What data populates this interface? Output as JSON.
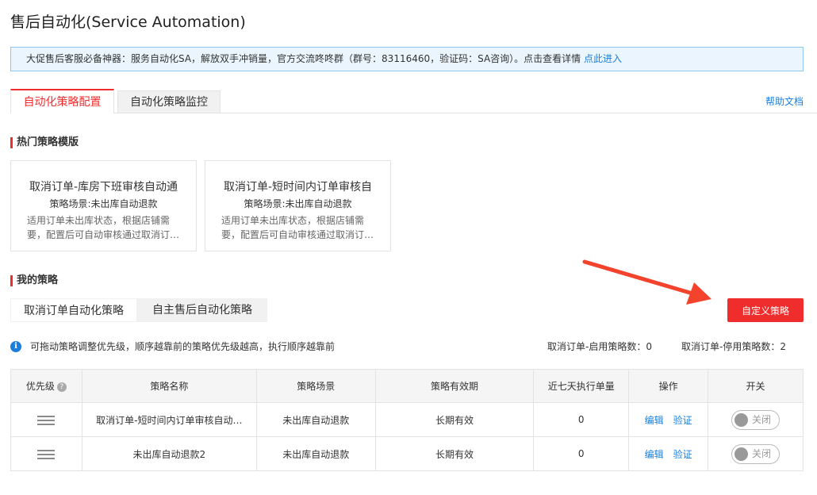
{
  "page": {
    "title": "售后自动化(Service Automation)"
  },
  "notice": {
    "text": "大促售后客服必备神器：服务自动化SA，解放双手冲销量，官方交流咚咚群（群号：83116460，验证码：SA咨询）。点击查看详情 ",
    "link": "点此进入"
  },
  "tabs": {
    "config": "自动化策略配置",
    "monitor": "自动化策略监控",
    "help": "帮助文档"
  },
  "hot": {
    "title": "热门策略模版",
    "cards": [
      {
        "title": "取消订单-库房下班审核自动通",
        "scene": "策略场景:未出库自动退款",
        "desc": "适用订单未出库状态，根据店铺需要，配置后可自动审核通过取消订…"
      },
      {
        "title": "取消订单-短时间内订单审核自",
        "scene": "策略场景:未出库自动退款",
        "desc": "适用订单未出库状态，根据店铺需要，配置后可自动审核通过取消订…"
      }
    ]
  },
  "mine": {
    "title": "我的策略",
    "subtabs": {
      "cancel": "取消订单自动化策略",
      "aftersale": "自主售后自动化策略"
    },
    "custom_button": "自定义策略",
    "tip": "可拖动策略调整优先级，顺序越靠前的策略优先级越高，执行顺序越靠前",
    "stats": {
      "enabled": "取消订单-启用策略数：0",
      "disabled": "取消订单-停用策略数：2"
    }
  },
  "table": {
    "headers": {
      "priority": "优先级",
      "name": "策略名称",
      "scene": "策略场景",
      "validity": "策略有效期",
      "count": "近七天执行单量",
      "ops": "操作",
      "switch": "开关"
    },
    "rows": [
      {
        "name": "取消订单-短时间内订单审核自动…",
        "scene": "未出库自动退款",
        "validity": "长期有效",
        "count": "0",
        "edit": "编辑",
        "verify": "验证",
        "switch": "关闭"
      },
      {
        "name": "未出库自动退款2",
        "scene": "未出库自动退款",
        "validity": "长期有效",
        "count": "0",
        "edit": "编辑",
        "verify": "验证",
        "switch": "关闭"
      }
    ]
  },
  "colors": {
    "accent": "#f02d2d",
    "link": "#1a7fdc",
    "notice_bg": "#eaf5fd"
  },
  "icons": [
    "info-icon",
    "help-icon",
    "drag-handle-icon",
    "arrow-icon"
  ]
}
